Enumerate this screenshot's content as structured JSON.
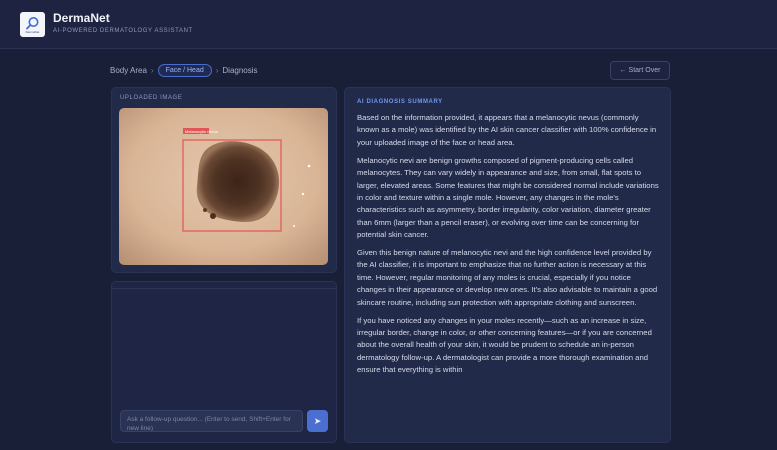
{
  "header": {
    "logo_text": "DermaNet",
    "title": "DermaNet",
    "subtitle": "AI-POWERED DERMATOLOGY ASSISTANT"
  },
  "breadcrumb": {
    "items": [
      "Body Area",
      "Face / Head",
      "Diagnosis"
    ],
    "separator": "›"
  },
  "start_over": {
    "icon": "arrow-left-icon",
    "label": "← Start Over"
  },
  "uploaded": {
    "label": "UPLOADED IMAGE",
    "detection_label": "Melanocytic nevus"
  },
  "chat": {
    "placeholder": "Ask a follow-up question... (Enter to send, Shift+Enter for new line)",
    "send_icon": "send-icon",
    "send_symbol": "➤"
  },
  "diagnosis": {
    "label": "AI DIAGNOSIS SUMMARY",
    "paragraphs": [
      "Based on the information provided, it appears that a melanocytic nevus (commonly known as a mole) was identified by the AI skin cancer classifier with 100% confidence in your uploaded image of the face or head area.",
      "Melanocytic nevi are benign growths composed of pigment-producing cells called melanocytes. They can vary widely in appearance and size, from small, flat spots to larger, elevated areas. Some features that might be considered normal include variations in color and texture within a single mole. However, any changes in the mole's characteristics such as asymmetry, border irregularity, color variation, diameter greater than 6mm (larger than a pencil eraser), or evolving over time can be concerning for potential skin cancer.",
      "Given this benign nature of melanocytic nevi and the high confidence level provided by the AI classifier, it is important to emphasize that no further action is necessary at this time. However, regular monitoring of any moles is crucial, especially if you notice changes in their appearance or develop new ones. It's also advisable to maintain a good skincare routine, including sun protection with appropriate clothing and sunscreen.",
      "If you have noticed any changes in your moles recently—such as an increase in size, irregular border, change in color, or other concerning features—or if you are concerned about the overall health of your skin, it would be prudent to schedule an in-person dermatology follow-up. A dermatologist can provide a more thorough examination and ensure that everything is within"
    ]
  },
  "colors": {
    "background": "#1a1f38",
    "card": "#222a4a",
    "accent": "#4a6fd0",
    "box": "#e25555"
  }
}
